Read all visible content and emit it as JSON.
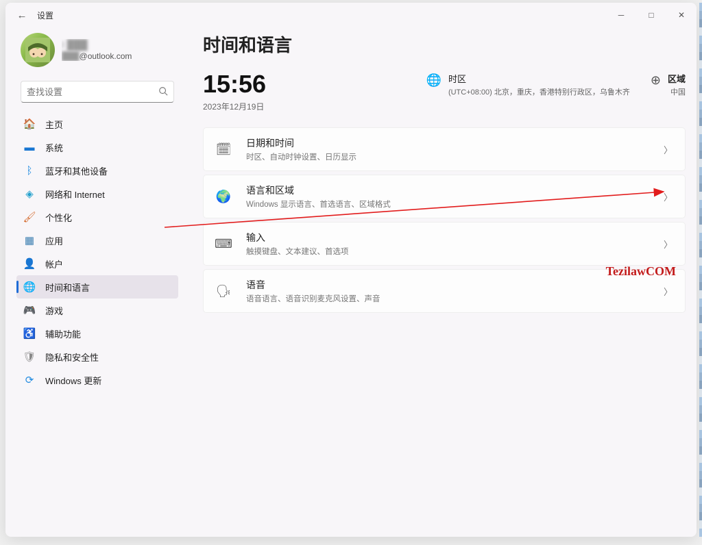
{
  "titlebar": {
    "title": "设置"
  },
  "user": {
    "name_blurred": "I ███",
    "email_blurred": "███",
    "email_suffix": "@outlook.com"
  },
  "search": {
    "placeholder": "查找设置"
  },
  "nav": {
    "home": "主页",
    "system": "系统",
    "bluetooth": "蓝牙和其他设备",
    "network": "网络和 Internet",
    "personalize": "个性化",
    "apps": "应用",
    "accounts": "帐户",
    "timelang": "时间和语言",
    "gaming": "游戏",
    "accessibility": "辅助功能",
    "privacy": "隐私和安全性",
    "update": "Windows 更新"
  },
  "page": {
    "title": "时间和语言",
    "clock": {
      "time": "15:56",
      "date": "2023年12月19日"
    },
    "timezone": {
      "label": "时区",
      "value": "(UTC+08:00) 北京，重庆，香港特别行政区，乌鲁木齐"
    },
    "region": {
      "label": "区域",
      "value": "中国"
    },
    "cards": {
      "datetime": {
        "title": "日期和时间",
        "subtitle": "时区、自动时钟设置、日历显示"
      },
      "langregion": {
        "title": "语言和区域",
        "subtitle": "Windows 显示语言、首选语言、区域格式"
      },
      "input": {
        "title": "输入",
        "subtitle": "触摸键盘、文本建议、首选项"
      },
      "speech": {
        "title": "语音",
        "subtitle": "语音语言、语音识别麦克风设置、声音"
      }
    }
  },
  "watermark": "TezilawCOM"
}
